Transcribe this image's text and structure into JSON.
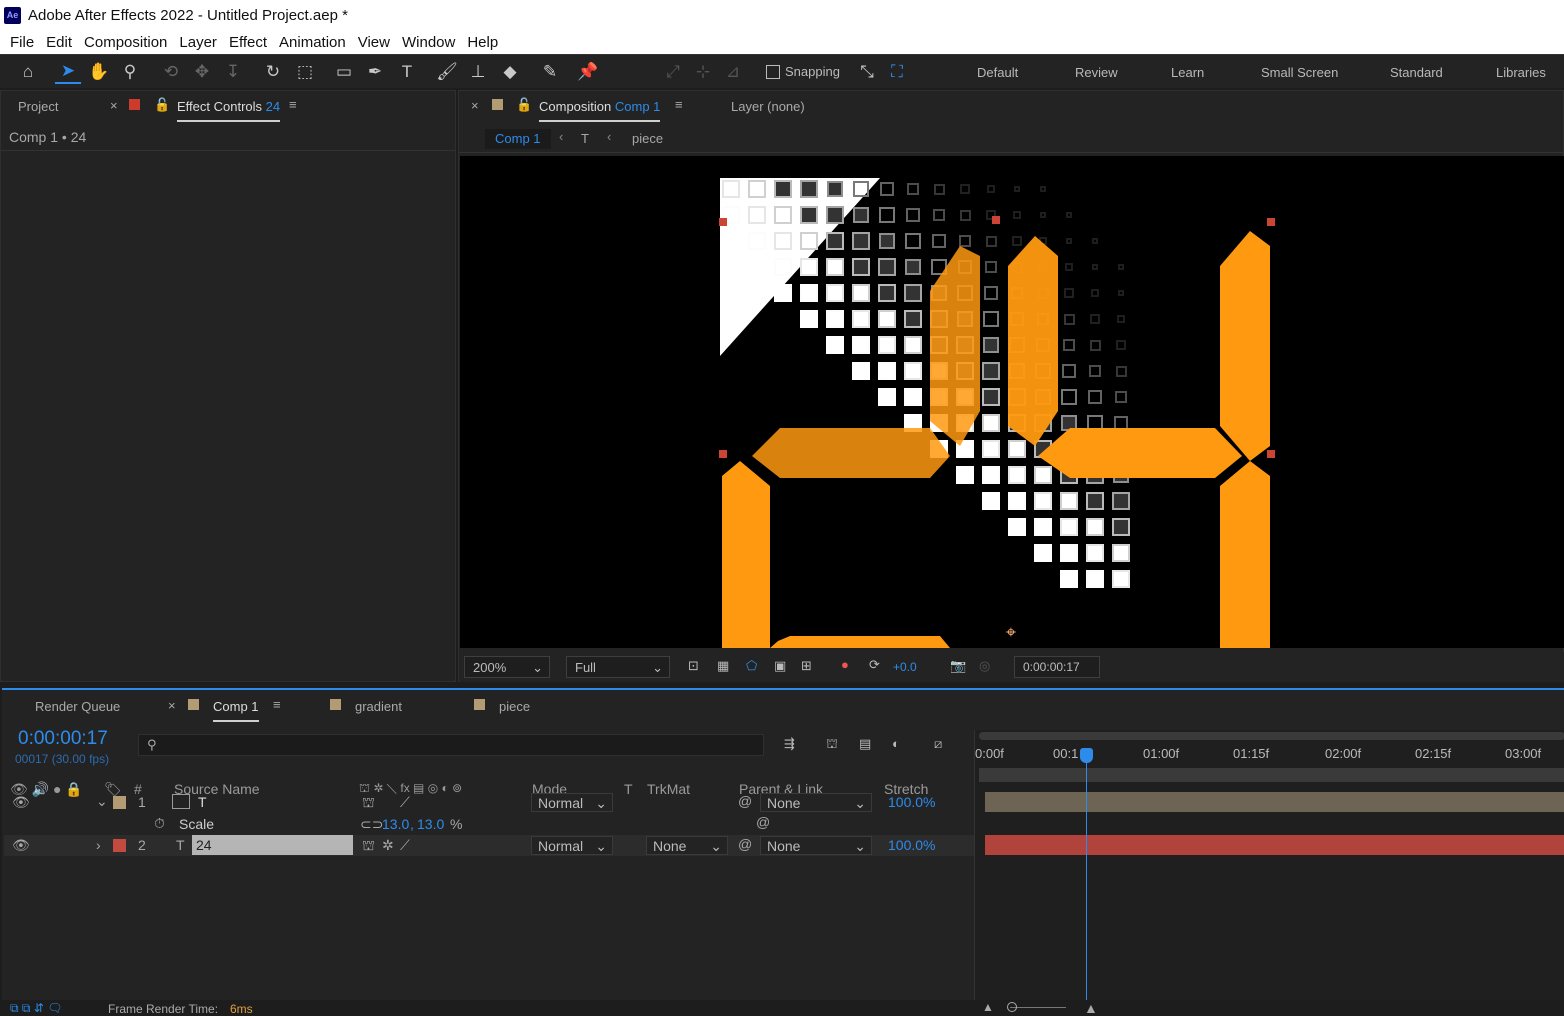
{
  "window": {
    "title": "Adobe After Effects 2022 - Untitled Project.aep *",
    "logo": "Ae"
  },
  "menu": [
    "File",
    "Edit",
    "Composition",
    "Layer",
    "Effect",
    "Animation",
    "View",
    "Window",
    "Help"
  ],
  "toolbar": {
    "snapping_label": "Snapping",
    "workspaces": [
      "Default",
      "Review",
      "Learn",
      "Small Screen",
      "Standard",
      "Libraries"
    ]
  },
  "left_panel": {
    "tab_project": "Project",
    "tab_effect_controls": "Effect Controls",
    "effect_controls_target": "24",
    "header": "Comp 1 • 24"
  },
  "comp_panel": {
    "tab_label": "Composition",
    "comp_name": "Comp 1",
    "layer_tab": "Layer (none)",
    "breadcrumbs": [
      "Comp 1",
      "T",
      "piece"
    ]
  },
  "viewer": {
    "zoom": "200%",
    "resolution": "Full",
    "exposure": "+0.0",
    "timecode": "0:00:00:17"
  },
  "timeline": {
    "tabs": [
      "Render Queue",
      "Comp 1",
      "gradient",
      "piece"
    ],
    "current_time": "0:00:00:17",
    "frame_info": "00017 (30.00 fps)",
    "search_placeholder": "",
    "columns": {
      "source_name": "Source Name",
      "mode": "Mode",
      "t": "T",
      "trkmat": "TrkMat",
      "parent": "Parent & Link",
      "stretch": "Stretch",
      "num": "#"
    },
    "ruler": [
      "0:00f",
      "00:1",
      "01:00f",
      "01:15f",
      "02:00f",
      "02:15f",
      "03:00f"
    ],
    "layers": [
      {
        "num": "1",
        "type": "T",
        "name": "T",
        "mode": "Normal",
        "trkmat": "",
        "parent": "None",
        "stretch": "100.0%",
        "label_color": "#b39b73"
      },
      {
        "num": "2",
        "type": "T",
        "name": "24",
        "mode": "Normal",
        "trkmat": "None",
        "parent": "None",
        "stretch": "100.0%",
        "label_color": "#c24a3e"
      }
    ],
    "scale_prop": {
      "label": "Scale",
      "x": "13.0",
      "y": "13.0",
      "unit": "%"
    }
  },
  "status": {
    "label": "Frame Render Time:",
    "value": "6ms"
  },
  "colors": {
    "accent": "#2d8ceb",
    "orange": "#ff9a10",
    "layer2": "#b0443c",
    "layer1bar": "#6d6453"
  }
}
